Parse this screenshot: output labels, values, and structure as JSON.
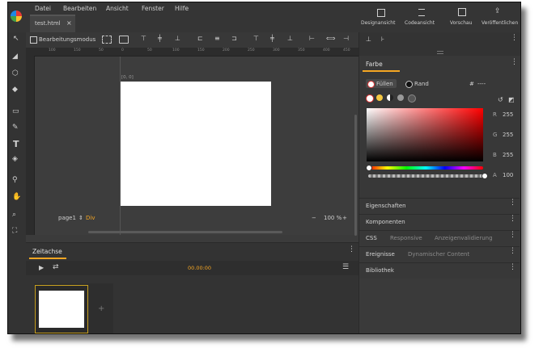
{
  "menu": {
    "datei": "Datei",
    "bearbeiten": "Bearbeiten",
    "ansicht": "Ansicht",
    "fenster": "Fenster",
    "hilfe": "Hilfe"
  },
  "tab": {
    "title": "test.html",
    "close": "×"
  },
  "top_actions": {
    "design": "Designansicht",
    "code": "Codeansicht",
    "preview": "Vorschau",
    "publish": "Veröffentlichen"
  },
  "toolbar": {
    "edit_mode": "Bearbeitungsmodus"
  },
  "canvas": {
    "coord": "[0, 0]",
    "page": "page1",
    "page_arrow": "⇕",
    "element": "Div",
    "zoom_minus": "−",
    "zoom": "100 %",
    "zoom_plus": "+"
  },
  "ruler": {
    "ticks": [
      "100",
      "150",
      "50",
      "0",
      "50",
      "100",
      "150",
      "200",
      "250",
      "300",
      "350",
      "400",
      "450"
    ]
  },
  "timeline": {
    "title": "Zeitachse",
    "time": "00.00:00"
  },
  "color": {
    "title": "Farbe",
    "fill": "Füllen",
    "stroke": "Rand",
    "hash": "#",
    "hex": "----",
    "r_label": "R",
    "r": "255",
    "g_label": "G",
    "g": "255",
    "b_label": "B",
    "b": "255",
    "a_label": "A",
    "a": "100"
  },
  "panels": {
    "properties": "Eigenschaften",
    "components": "Komponenten",
    "css_tabs": [
      "CSS",
      "Responsive",
      "Anzeigenvalidierung"
    ],
    "events_tabs": [
      "Ereignisse",
      "Dynamischer Content"
    ],
    "library": "Bibliothek"
  },
  "colors": {
    "accent": "#f5a623",
    "bg": "#3b3b3b",
    "dark": "#2f2f2f",
    "canvas": "#ffffff"
  }
}
